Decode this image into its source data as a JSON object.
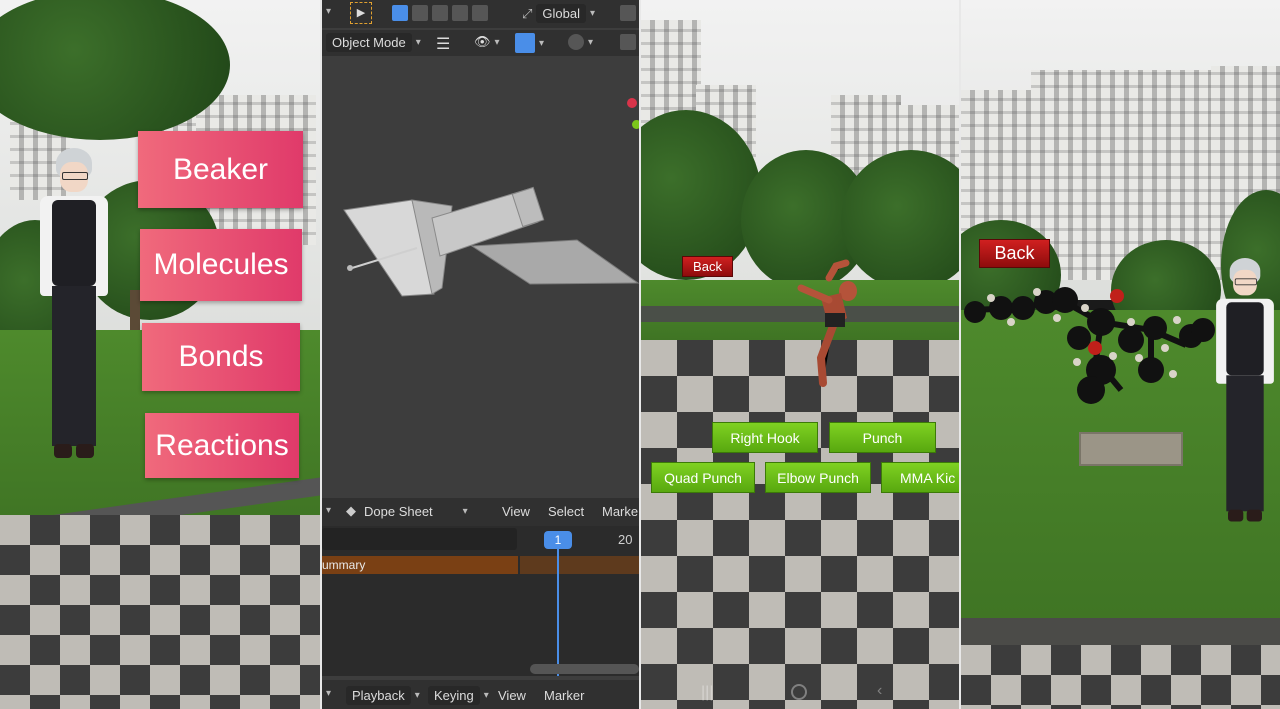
{
  "panel1": {
    "menu": [
      "Beaker",
      "Molecules",
      "Bonds",
      "Reactions"
    ]
  },
  "panel2": {
    "header": {
      "global_label": "Global",
      "mode_label": "Object Mode"
    },
    "dope_sheet": {
      "editor_label": "Dope Sheet",
      "menu": [
        "View",
        "Select",
        "Marke"
      ],
      "current_frame": "1",
      "frame_tick": "20",
      "channel": "ummary"
    },
    "timeline_footer": {
      "items": [
        "Playback",
        "Keying",
        "View",
        "Marker"
      ]
    }
  },
  "panel3": {
    "back_label": "Back",
    "moves": [
      "Right Hook",
      "Punch",
      "Quad Punch",
      "Elbow Punch",
      "MMA Kic"
    ]
  },
  "panel4": {
    "back_label": "Back"
  },
  "colors": {
    "menu_pink": "#e8506f",
    "action_green": "#6cbf17",
    "back_red": "#b81414",
    "blender_accent": "#4a8ee8"
  }
}
